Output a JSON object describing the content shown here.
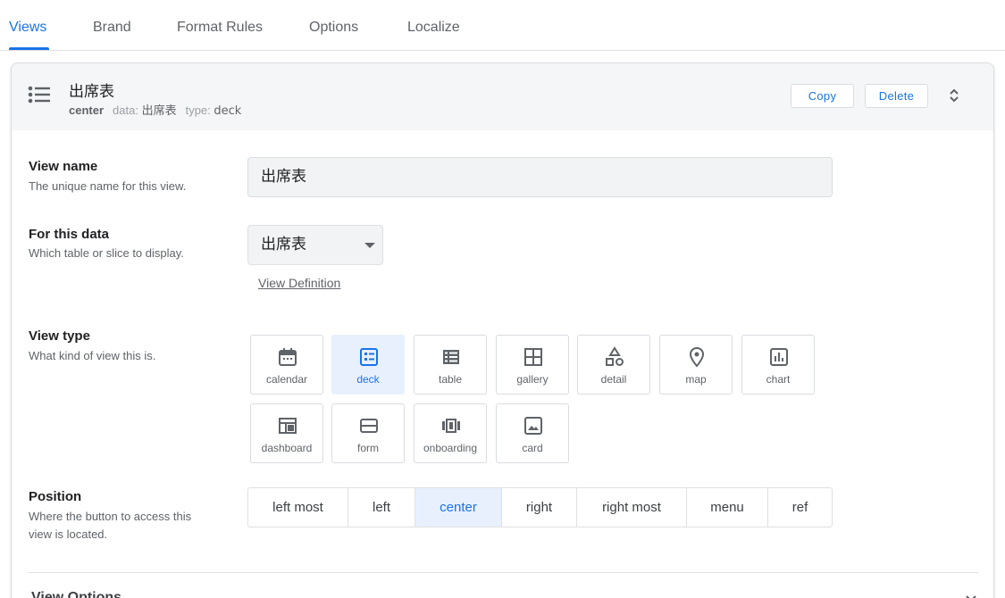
{
  "tabs": [
    {
      "label": "Views",
      "active": true
    },
    {
      "label": "Brand",
      "active": false
    },
    {
      "label": "Format Rules",
      "active": false
    },
    {
      "label": "Options",
      "active": false
    },
    {
      "label": "Localize",
      "active": false
    }
  ],
  "header": {
    "icon": "list-icon",
    "title": "出席表",
    "position": "center",
    "data_label": "data:",
    "data_value": "出席表",
    "type_label": "type:",
    "type_value": "deck",
    "copy_label": "Copy",
    "delete_label": "Delete",
    "sort_icon": "unfold-icon"
  },
  "view_name": {
    "label": "View name",
    "description": "The unique name for this view.",
    "value": "出席表"
  },
  "for_this_data": {
    "label": "For this data",
    "description": "Which table or slice to display.",
    "value": "出席表",
    "link": "View Definition"
  },
  "view_type": {
    "label": "View type",
    "description": "What kind of view this is.",
    "options": [
      "calendar",
      "deck",
      "table",
      "gallery",
      "detail",
      "map",
      "chart",
      "dashboard",
      "form",
      "onboarding",
      "card"
    ],
    "selected": "deck"
  },
  "position": {
    "label": "Position",
    "description_line1": "Where the button to access this",
    "description_line2": "view is located.",
    "options": [
      "left most",
      "left",
      "center",
      "right",
      "right most",
      "menu",
      "ref"
    ],
    "selected": "center"
  },
  "section_footer": {
    "label": "View Options"
  },
  "colors": {
    "accent": "#1a73e8",
    "selected_bg": "#e8f0fe",
    "header_bg": "#f5f6f7"
  }
}
